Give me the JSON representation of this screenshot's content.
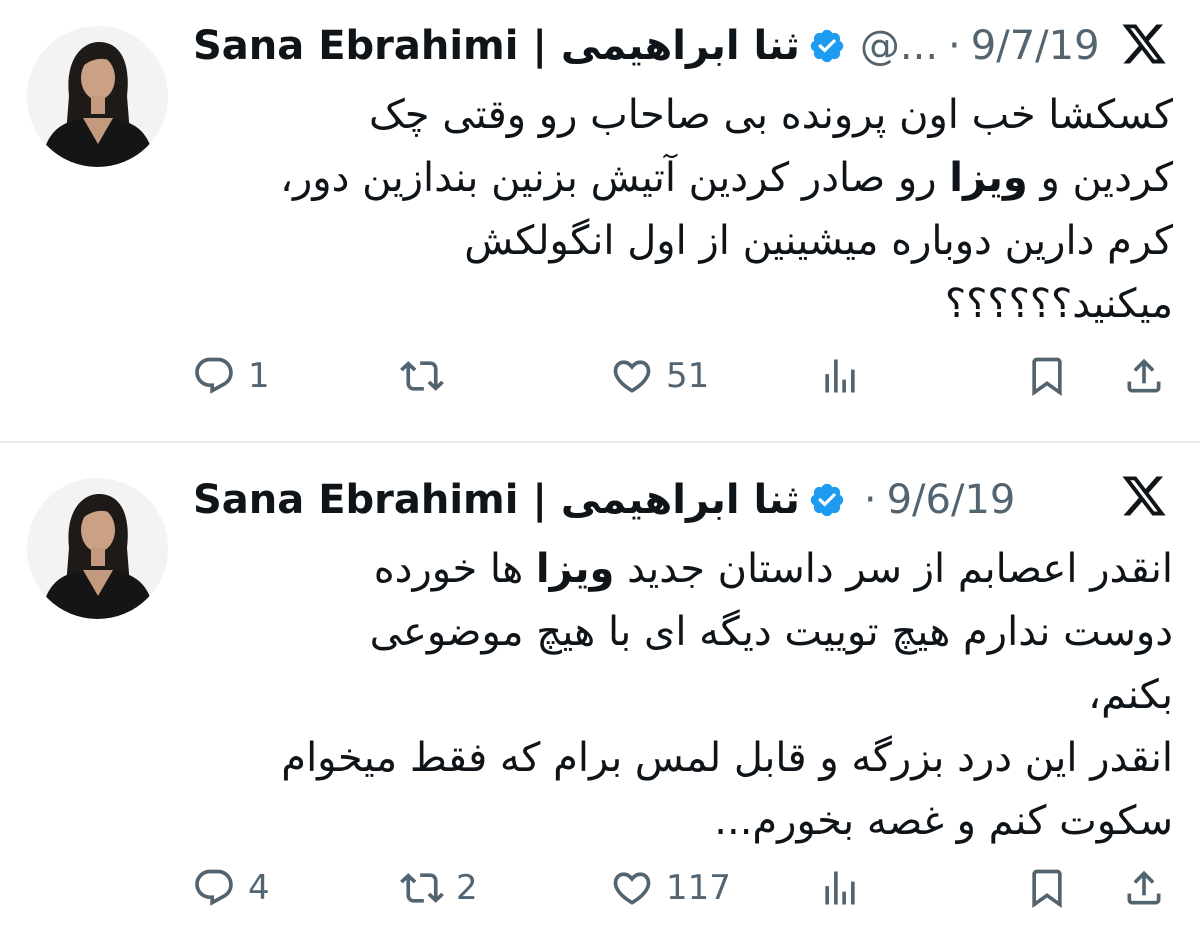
{
  "tweets": [
    {
      "author_name": "Sana Ebrahimi | ثنا ابراهیمی",
      "handle": "@...",
      "separator": "·",
      "date": "9/7/19",
      "lines": [
        {
          "pre": "کسکشا خب اون پرونده بی صاحاب رو وقتی چک",
          "bold": "",
          "post": ""
        },
        {
          "pre": "کردین و ",
          "bold": "ویزا",
          "post": " رو صادر کردین آتیش بزنین بندازین دور،"
        },
        {
          "pre": "کرم دارین دوباره میشینین از اول انگولکش",
          "bold": "",
          "post": ""
        },
        {
          "pre": "میکنید؟؟؟؟؟؟",
          "bold": "",
          "post": ""
        }
      ],
      "actions": {
        "reply_count": "1",
        "retweet_count": "",
        "like_count": "51"
      }
    },
    {
      "author_name": "Sana Ebrahimi | ثنا ابراهیمی",
      "separator": "·",
      "date": "9/6/19",
      "lines": [
        {
          "pre": "انقدر اعصابم از سر داستان جدید ",
          "bold": "ویزا",
          "post": " ها خورده"
        },
        {
          "pre": "دوست ندارم هیچ توییت دیگه ای با هیچ موضوعی",
          "bold": "",
          "post": ""
        },
        {
          "pre": "بکنم،",
          "bold": "",
          "post": ""
        },
        {
          "pre": "انقدر این درد بزرگه و قابل لمس برام که فقط میخوام",
          "bold": "",
          "post": ""
        },
        {
          "pre": "سکوت کنم و غصه بخورم...",
          "bold": "",
          "post": ""
        }
      ],
      "actions": {
        "reply_count": "4",
        "retweet_count": "2",
        "like_count": "117"
      }
    }
  ],
  "colors": {
    "verified_badge": "#1d9bf0",
    "secondary_text": "#536471",
    "primary_text": "#0f1419",
    "divider": "#e7e9ec"
  },
  "icons": [
    "reply-icon",
    "retweet-icon",
    "like-icon",
    "views-icon",
    "bookmark-icon",
    "share-icon",
    "x-logo-icon",
    "verified-badge-icon"
  ]
}
